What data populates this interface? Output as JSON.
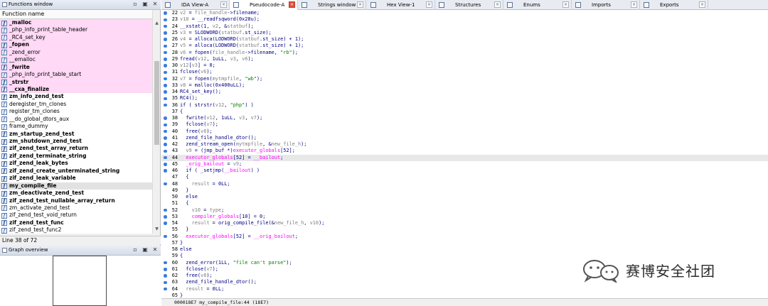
{
  "functions_window": {
    "title": "Functions window",
    "column_header": "Function name",
    "items": [
      {
        "name": "_malloc",
        "style": "pink bold"
      },
      {
        "name": "_php_info_print_table_header",
        "style": "pink"
      },
      {
        "name": "_RC4_set_key",
        "style": "pink"
      },
      {
        "name": "_fopen",
        "style": "pink bold"
      },
      {
        "name": "_zend_error",
        "style": "pink"
      },
      {
        "name": "__emalloc",
        "style": "pink"
      },
      {
        "name": "_fwrite",
        "style": "pink bold"
      },
      {
        "name": "_php_info_print_table_start",
        "style": "pink"
      },
      {
        "name": "_strstr",
        "style": "pink bold"
      },
      {
        "name": "__cxa_finalize",
        "style": "pink bold"
      },
      {
        "name": "zm_info_zend_test",
        "style": "bold"
      },
      {
        "name": "deregister_tm_clones",
        "style": ""
      },
      {
        "name": "register_tm_clones",
        "style": ""
      },
      {
        "name": "__do_global_dtors_aux",
        "style": ""
      },
      {
        "name": "frame_dummy",
        "style": ""
      },
      {
        "name": "zm_startup_zend_test",
        "style": "bold"
      },
      {
        "name": "zm_shutdown_zend_test",
        "style": "bold"
      },
      {
        "name": "zif_zend_test_array_return",
        "style": "bold"
      },
      {
        "name": "zif_zend_terminate_string",
        "style": "bold"
      },
      {
        "name": "zif_zend_leak_bytes",
        "style": "bold"
      },
      {
        "name": "zif_zend_create_unterminated_string",
        "style": "bold"
      },
      {
        "name": "zif_zend_leak_variable",
        "style": "bold"
      },
      {
        "name": "my_compile_file",
        "style": "sel bold"
      },
      {
        "name": "zm_deactivate_zend_test",
        "style": "bold"
      },
      {
        "name": "zif_zend_test_nullable_array_return",
        "style": "bold"
      },
      {
        "name": "zm_activate_zend_test",
        "style": ""
      },
      {
        "name": "zif_zend_test_void_return",
        "style": ""
      },
      {
        "name": "zif_zend_test_func",
        "style": "bold"
      },
      {
        "name": "zif_zend_test_func2",
        "style": ""
      }
    ],
    "line_status": "Line 38 of 72"
  },
  "graph_overview": {
    "title": "Graph overview"
  },
  "tabs": [
    {
      "label": "IDA View-A",
      "active": false
    },
    {
      "label": "Pseudocode-A",
      "active": true
    },
    {
      "label": "Strings window",
      "active": false
    },
    {
      "label": "Hex View-1",
      "active": false
    },
    {
      "label": "Structures",
      "active": false
    },
    {
      "label": "Enums",
      "active": false
    },
    {
      "label": "Imports",
      "active": false
    },
    {
      "label": "Exports",
      "active": false
    }
  ],
  "code_lines": [
    {
      "n": "22",
      "t": "v2 = file_handle->filename;",
      "dot": true
    },
    {
      "n": "23",
      "t": "v18 = __readfsqword(0x28u);",
      "dot": true
    },
    {
      "n": "24",
      "t": "__xstat(1, v2, &statbuf);",
      "dot": true
    },
    {
      "n": "25",
      "t": "v3 = SLODWORD(statbuf.st_size);",
      "dot": true
    },
    {
      "n": "26",
      "t": "v4 = alloca(LODWORD(statbuf.st_size) + 1);",
      "dot": true
    },
    {
      "n": "27",
      "t": "v5 = alloca(LODWORD(statbuf.st_size) + 1);",
      "dot": true
    },
    {
      "n": "28",
      "t": "v6 = fopen(file_handle->filename, \"rb\");",
      "dot": true
    },
    {
      "n": "29",
      "t": "fread(v12, 1uLL, v3, v6);",
      "dot": true
    },
    {
      "n": "30",
      "t": "v12[v3] = 0;",
      "dot": true
    },
    {
      "n": "31",
      "t": "fclose(v6);",
      "dot": true
    },
    {
      "n": "32",
      "t": "v7 = fopen(mytmpfile, \"wb\");",
      "dot": true
    },
    {
      "n": "33",
      "t": "v8 = malloc(0x400uLL);",
      "dot": true
    },
    {
      "n": "34",
      "t": "RC4_set_key();",
      "dot": true
    },
    {
      "n": "35",
      "t": "RC4();",
      "dot": true
    },
    {
      "n": "36",
      "t": "if ( strstr(v12, \"php\") )",
      "dot": true
    },
    {
      "n": "37",
      "t": "{",
      "dot": false
    },
    {
      "n": "38",
      "t": "  fwrite(v12, 1uLL, v3, v7);",
      "dot": true
    },
    {
      "n": "39",
      "t": "  fclose(v7);",
      "dot": true
    },
    {
      "n": "40",
      "t": "  free(v8);",
      "dot": true
    },
    {
      "n": "41",
      "t": "  zend_file_handle_dtor();",
      "dot": true
    },
    {
      "n": "42",
      "t": "  zend_stream_open(mytmpfile, &new_file_h);",
      "dot": true
    },
    {
      "n": "43",
      "t": "  v9 = (jmp_buf *)executor_globals[52];",
      "dot": true
    },
    {
      "n": "44",
      "t": "  executor_globals[52] = __bailout;",
      "dot": true,
      "hl": true
    },
    {
      "n": "45",
      "t": "  _orig_bailout = v9;",
      "dot": true
    },
    {
      "n": "46",
      "t": "  if ( _setjmp(__bailout) )",
      "dot": true
    },
    {
      "n": "47",
      "t": "  {",
      "dot": false
    },
    {
      "n": "48",
      "t": "    result = 0LL;",
      "dot": true
    },
    {
      "n": "49",
      "t": "  }",
      "dot": false
    },
    {
      "n": "50",
      "t": "  else",
      "dot": false
    },
    {
      "n": "51",
      "t": "  {",
      "dot": false
    },
    {
      "n": "52",
      "t": "    v10 = type;",
      "dot": true
    },
    {
      "n": "53",
      "t": "    compiler_globals[10] = 0;",
      "dot": true
    },
    {
      "n": "54",
      "t": "    result = orig_compile_file(&new_file_h, v10);",
      "dot": true
    },
    {
      "n": "55",
      "t": "  }",
      "dot": false
    },
    {
      "n": "56",
      "t": "  executor_globals[52] = __orig_bailout;",
      "dot": true
    },
    {
      "n": "57",
      "t": "}",
      "dot": false
    },
    {
      "n": "58",
      "t": "else",
      "dot": false
    },
    {
      "n": "59",
      "t": "{",
      "dot": false
    },
    {
      "n": "60",
      "t": "  zend_error(1LL, \"file can't parse\");",
      "dot": true
    },
    {
      "n": "61",
      "t": "  fclose(v7);",
      "dot": true
    },
    {
      "n": "62",
      "t": "  free(v8);",
      "dot": true
    },
    {
      "n": "63",
      "t": "  zend_file_handle_dtor();",
      "dot": true
    },
    {
      "n": "64",
      "t": "  result = 0LL;",
      "dot": true
    },
    {
      "n": "65",
      "t": "}",
      "dot": false
    },
    {
      "n": "66",
      "t": "return result;",
      "dot": true
    },
    {
      "n": "67",
      "t": "}",
      "dot": true
    }
  ],
  "status_bar": "000018E7 my_compile_file:44 (18E7)",
  "watermark": {
    "text": "赛博安全社团"
  },
  "colors": {
    "local_var": "#808080",
    "global": "#ff00ff",
    "string": "#008000",
    "code": "#000080",
    "pink_row": "#ffd9f5",
    "highlight_line": "#e8e8e8",
    "dot": "#3a7ce0"
  }
}
